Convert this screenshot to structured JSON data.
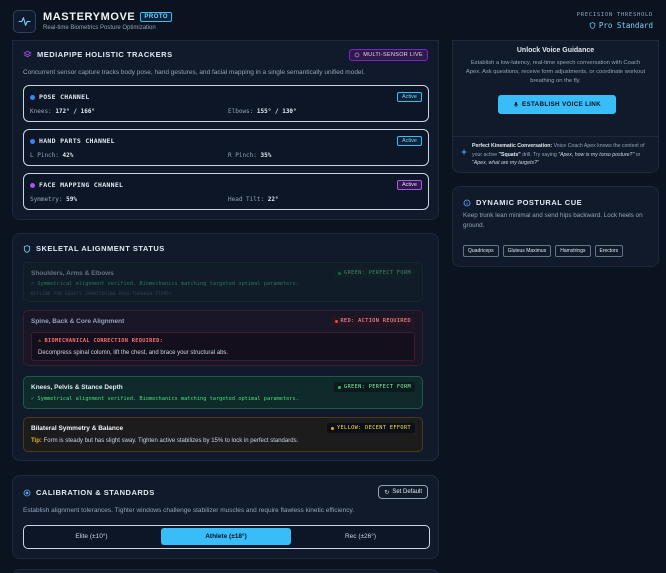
{
  "header": {
    "brand": "MASTERYMOVE",
    "badge": "PROTO",
    "tagline": "Real-time Biometrics Posture Optimization",
    "threshold_label": "PRECISION THRESHOLD",
    "threshold_value": "Pro Standard"
  },
  "trackers": {
    "title": "MEDIAPIPE HOLISTIC TRACKERS",
    "badge": "MULTI-SENSOR LIVE",
    "description": "Concurrent sensor capture tracks body pose, hand gestures, and facial mapping in a single semantically unified model.",
    "channels": [
      {
        "title": "POSE CHANNEL",
        "status": "Active",
        "k1": "Knees:",
        "v1": "172° / 166°",
        "k2": "Elbows:",
        "v2": "155° / 130°"
      },
      {
        "title": "HAND PARTS CHANNEL",
        "status": "Active",
        "k1": "L Pinch:",
        "v1": "42%",
        "k2": "R Pinch:",
        "v2": "35%"
      },
      {
        "title": "FACE MAPPING CHANNEL",
        "status": "Active",
        "k1": "Symmetry:",
        "v1": "59%",
        "k2": "Head Tilt:",
        "v2": "22°"
      }
    ]
  },
  "alignment": {
    "title": "SKELETAL ALIGNMENT STATUS",
    "rows": [
      {
        "title": "Shoulders, Arms & Elbows",
        "badge": "GREEN: PERFECT FORM",
        "line": "✓ Symmetrical alignment verified. Biomechanics matching targeted optimal parameters.",
        "sub": "OFFLINE FOR SQUATS (MONITORING PASS-THROUGH ITEMS)"
      },
      {
        "title": "Spine, Back & Core Alignment",
        "badge": "RED: ACTION REQUIRED",
        "warn_title": "BIOMECHANICAL CORRECTION REQUIRED:",
        "warn_text": "Decompress spinal column, lift the chest, and brace your structural abs."
      },
      {
        "title": "Knees, Pelvis & Stance Depth",
        "badge": "GREEN: PERFECT FORM",
        "line": "✓ Symmetrical alignment verified. Biomechanics matching targeted optimal parameters."
      },
      {
        "title": "Bilateral Symmetry & Balance",
        "badge": "YELLOW: DECENT EFFORT",
        "tip_label": "Tip:",
        "tip": "Form is steady but has slight sway. Tighten active stabilizes by 15% to lock in perfect standards."
      }
    ]
  },
  "calibration": {
    "title": "CALIBRATION & STANDARDS",
    "reset": "Set Default",
    "description": "Establish alignment tolerances. Tighter windows challenge stabilizer muscles and require flawless kinetic efficiency.",
    "options": [
      "Elite (±10°)",
      "Athlete (±18°)",
      "Rec (±26°)"
    ],
    "selected": 1
  },
  "voice": {
    "title": "Unlock Voice Guidance",
    "description": "Establish a low-latency, real-time speech conversation with Coach Apex. Ask questions, receive form adjustments, or coordinate workout breathing on the fly.",
    "button": "ESTABLISH VOICE LINK",
    "note_bold": "Perfect Kinematic Conversation:",
    "note_a": " Voice Coach Apex knows the context of your active ",
    "note_drill": "\"Squats\"",
    "note_b": " drill. Try saying ",
    "note_q1": "\"Apex, how is my torso posture?\"",
    "note_or": " or ",
    "note_q2": "\"Apex, what are my targets?\""
  },
  "cue": {
    "title": "DYNAMIC POSTURAL CUE",
    "text": "Keep trunk lean minimal and send hips backward. Lock heels on ground.",
    "tags": [
      "Quadriceps",
      "Gluteus Maximus",
      "Hamstrings",
      "Erectors"
    ]
  },
  "colors": {
    "accent": "#38bdf8",
    "green": "#22c55e",
    "red": "#ef4444",
    "yellow": "#eab308",
    "purple": "#a855f7"
  }
}
